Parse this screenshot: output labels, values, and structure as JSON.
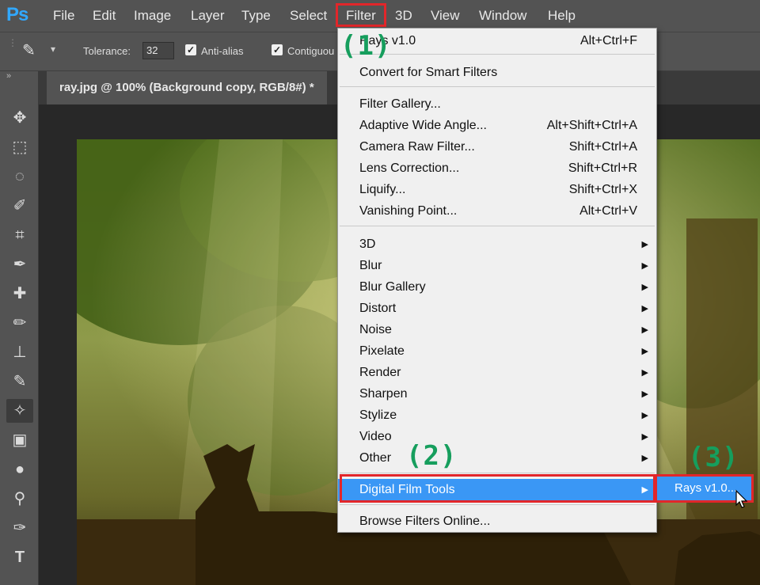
{
  "app": {
    "logo": "Ps"
  },
  "menubar": {
    "items": [
      "File",
      "Edit",
      "Image",
      "Layer",
      "Type",
      "Select",
      "Filter",
      "3D",
      "View",
      "Window",
      "Help"
    ]
  },
  "options": {
    "tolerance_label": "Tolerance:",
    "tolerance_value": "32",
    "antialias_label": "Anti-alias",
    "contiguous_label": "Contiguou"
  },
  "document": {
    "tab_title": "ray.jpg @ 100% (Background copy, RGB/8#) *"
  },
  "filter_menu": {
    "last_filter": {
      "label": "Rays v1.0",
      "shortcut": "Alt+Ctrl+F"
    },
    "convert": "Convert for Smart Filters",
    "group2": [
      {
        "label": "Filter Gallery...",
        "shortcut": ""
      },
      {
        "label": "Adaptive Wide Angle...",
        "shortcut": "Alt+Shift+Ctrl+A"
      },
      {
        "label": "Camera Raw Filter...",
        "shortcut": "Shift+Ctrl+A"
      },
      {
        "label": "Lens Correction...",
        "shortcut": "Shift+Ctrl+R"
      },
      {
        "label": "Liquify...",
        "shortcut": "Shift+Ctrl+X"
      },
      {
        "label": "Vanishing Point...",
        "shortcut": "Alt+Ctrl+V"
      }
    ],
    "submenus": [
      "3D",
      "Blur",
      "Blur Gallery",
      "Distort",
      "Noise",
      "Pixelate",
      "Render",
      "Sharpen",
      "Stylize",
      "Video",
      "Other"
    ],
    "highlighted": "Digital Film Tools",
    "browse": "Browse Filters Online..."
  },
  "submenu": {
    "item": "Rays v1.0..."
  },
  "callouts": [
    "(1)",
    "(2)",
    "(3)"
  ],
  "colors": {
    "highlight": "#3a97f5",
    "annotation_box": "#e2262a",
    "callout_text": "#169e5d"
  }
}
